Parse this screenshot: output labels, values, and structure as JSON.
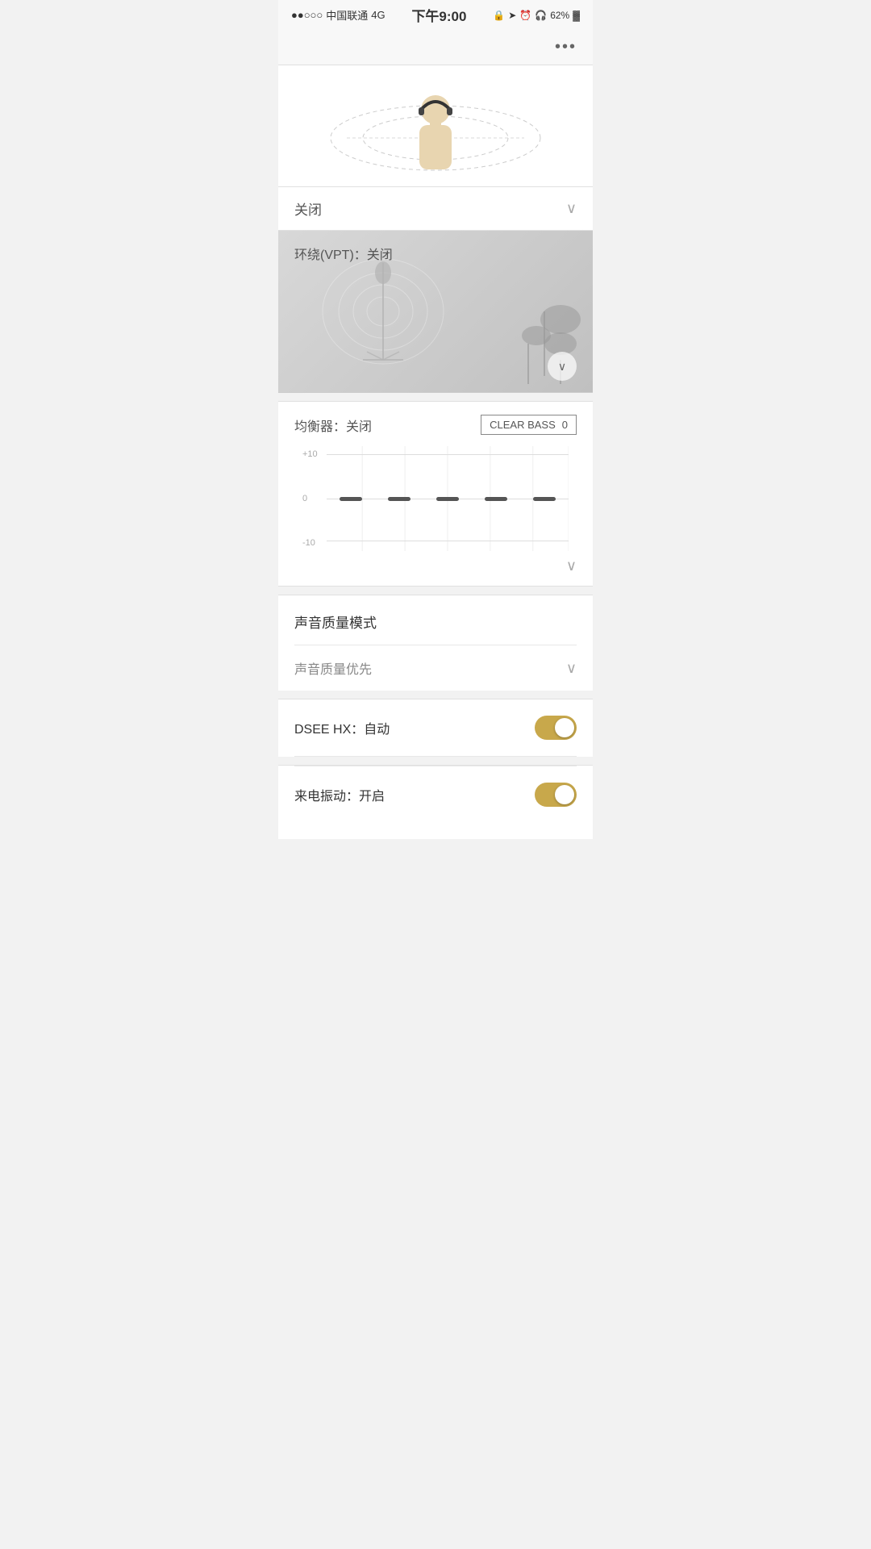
{
  "statusBar": {
    "carrier": "中国联通",
    "network": "4G",
    "time": "下午9:00",
    "battery": "62%"
  },
  "moreButton": "•••",
  "closedLabel": "关闭",
  "surroundLabel": "环绕(VPT)：关闭",
  "equalizer": {
    "title": "均衡器：关闭",
    "clearBassLabel": "CLEAR BASS",
    "clearBassValue": "0",
    "yAxisLabels": [
      "+10",
      "0",
      "-10"
    ],
    "bands": [
      {
        "value": 0
      },
      {
        "value": 0
      },
      {
        "value": 0
      },
      {
        "value": 0
      },
      {
        "value": 0
      }
    ]
  },
  "soundQuality": {
    "sectionTitle": "声音质量模式",
    "optionLabel": "声音质量优先"
  },
  "dseeHx": {
    "label": "DSEE HX：自动",
    "enabled": true
  },
  "vibrate": {
    "label": "来电振动：开启",
    "enabled": true
  }
}
